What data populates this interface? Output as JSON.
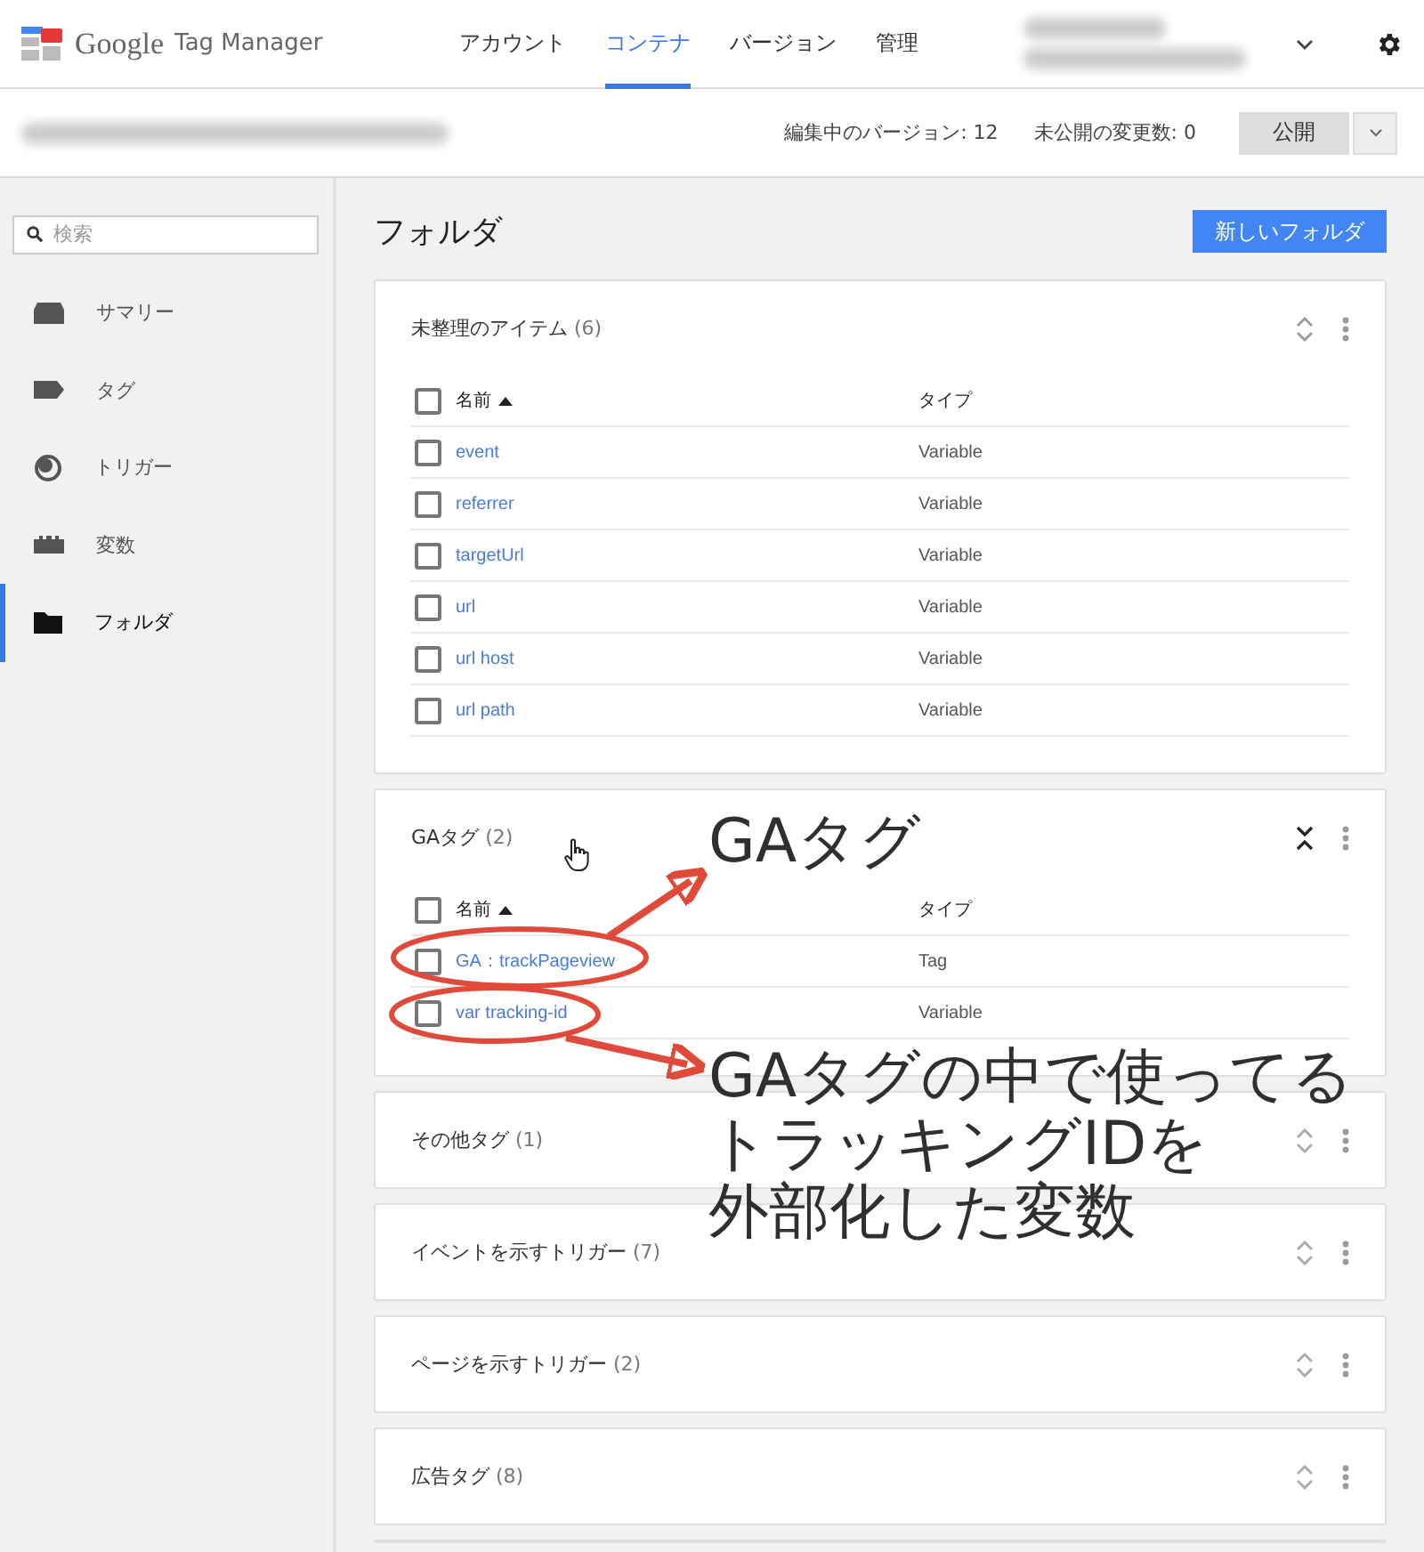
{
  "header": {
    "product": [
      "Google",
      "Tag Manager"
    ],
    "nav": [
      {
        "label": "アカウント",
        "selected": false
      },
      {
        "label": "コンテナ",
        "selected": true
      },
      {
        "label": "バージョン",
        "selected": false
      },
      {
        "label": "管理",
        "selected": false
      }
    ]
  },
  "subheader": {
    "stats": [
      "編集中のバージョン: 12",
      "未公開の変更数: 0"
    ],
    "publish": "公開"
  },
  "sidebar": {
    "search": {
      "placeholder": "検索"
    },
    "items": [
      {
        "label": "サマリー",
        "kind": "summary",
        "selected": false
      },
      {
        "label": "タグ",
        "kind": "tag",
        "selected": false
      },
      {
        "label": "トリガー",
        "kind": "trigger",
        "selected": false
      },
      {
        "label": "変数",
        "kind": "variable",
        "selected": false
      },
      {
        "label": "フォルダ",
        "kind": "folder",
        "selected": true
      }
    ]
  },
  "main": {
    "title": "フォルダ",
    "new_button": "新しいフォルダ",
    "folders": [
      {
        "name": "未整理のアイテム",
        "count": "(6)",
        "expanded": true,
        "hovered": false,
        "columns": [
          "名前",
          "タイプ"
        ],
        "all_checked": false,
        "rows": [
          {
            "cells": [
              "event",
              "Variable"
            ],
            "checked": false
          },
          {
            "cells": [
              "referrer",
              "Variable"
            ],
            "checked": false
          },
          {
            "cells": [
              "targetUrl",
              "Variable"
            ],
            "checked": false
          },
          {
            "cells": [
              "url",
              "Variable"
            ],
            "checked": false
          },
          {
            "cells": [
              "url host",
              "Variable"
            ],
            "checked": false
          },
          {
            "cells": [
              "url path",
              "Variable"
            ],
            "checked": false
          }
        ]
      },
      {
        "name": "GAタグ",
        "count": "(2)",
        "expanded": true,
        "hovered": true,
        "columns": [
          "名前",
          "タイプ"
        ],
        "all_checked": false,
        "rows": [
          {
            "cells": [
              "GA：trackPageview",
              "Tag"
            ],
            "checked": false
          },
          {
            "cells": [
              "var tracking-id",
              "Variable"
            ],
            "checked": false
          }
        ]
      },
      {
        "name": "その他タグ",
        "count": "(1)",
        "expanded": false,
        "hovered": false
      },
      {
        "name": "イベントを示すトリガー",
        "count": "(7)",
        "expanded": false,
        "hovered": false
      },
      {
        "name": "ページを示すトリガー",
        "count": "(2)",
        "expanded": false,
        "hovered": false
      },
      {
        "name": "広告タグ",
        "count": "(8)",
        "expanded": false,
        "hovered": false
      }
    ]
  },
  "annotations": [
    {
      "lines": [
        "GAタグ"
      ]
    },
    {
      "lines": [
        "GAタグの中で使ってる",
        "トラッキングIDを",
        "外部化した変数"
      ]
    }
  ]
}
